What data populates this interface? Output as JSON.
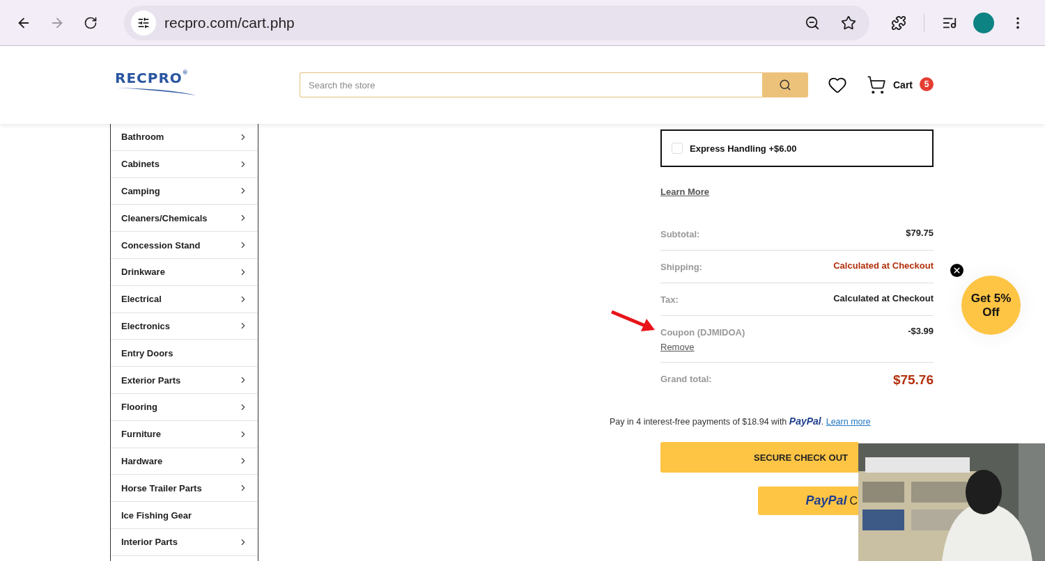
{
  "browser": {
    "url": "recpro.com/cart.php"
  },
  "header": {
    "logo": "RECPRO",
    "logo_mark": "®",
    "search": {
      "placeholder": "Search the store"
    },
    "cart": {
      "label": "Cart",
      "count": "5"
    }
  },
  "sidebar": {
    "items": [
      {
        "label": "Bathroom",
        "has_submenu": true
      },
      {
        "label": "Cabinets",
        "has_submenu": true
      },
      {
        "label": "Camping",
        "has_submenu": true
      },
      {
        "label": "Cleaners/Chemicals",
        "has_submenu": true
      },
      {
        "label": "Concession Stand",
        "has_submenu": true
      },
      {
        "label": "Drinkware",
        "has_submenu": true
      },
      {
        "label": "Electrical",
        "has_submenu": true
      },
      {
        "label": "Electronics",
        "has_submenu": true
      },
      {
        "label": "Entry Doors",
        "has_submenu": false
      },
      {
        "label": "Exterior Parts",
        "has_submenu": true
      },
      {
        "label": "Flooring",
        "has_submenu": true
      },
      {
        "label": "Furniture",
        "has_submenu": true
      },
      {
        "label": "Hardware",
        "has_submenu": true
      },
      {
        "label": "Horse Trailer Parts",
        "has_submenu": true
      },
      {
        "label": "Ice Fishing Gear",
        "has_submenu": false
      },
      {
        "label": "Interior Parts",
        "has_submenu": true
      }
    ]
  },
  "cart_summary": {
    "express_handling": {
      "label": "Express Handling +$6.00",
      "checked": false
    },
    "learn_more": "Learn More",
    "rows": [
      {
        "label": "Subtotal:",
        "value": "$79.75",
        "kind": "plain"
      },
      {
        "label": "Shipping:",
        "value": "Calculated at Checkout",
        "kind": "accent"
      },
      {
        "label": "Tax:",
        "value": "Calculated at Checkout",
        "kind": "plain"
      },
      {
        "label": "Coupon (DJMIDOA)",
        "value": "-$3.99",
        "kind": "coupon",
        "action": "Remove"
      },
      {
        "label": "Grand total:",
        "value": "$75.76",
        "kind": "total"
      }
    ],
    "paypal_note": {
      "text": "Pay in 4 interest-free payments of $18.94 with",
      "brand": "PayPal",
      "period": ".",
      "link": "Learn more"
    },
    "checkout_button": "SECURE CHECK OUT",
    "paypal_button": {
      "brand": "PayPal",
      "text": "C"
    }
  },
  "promo": {
    "label": "Get 5% Off"
  }
}
